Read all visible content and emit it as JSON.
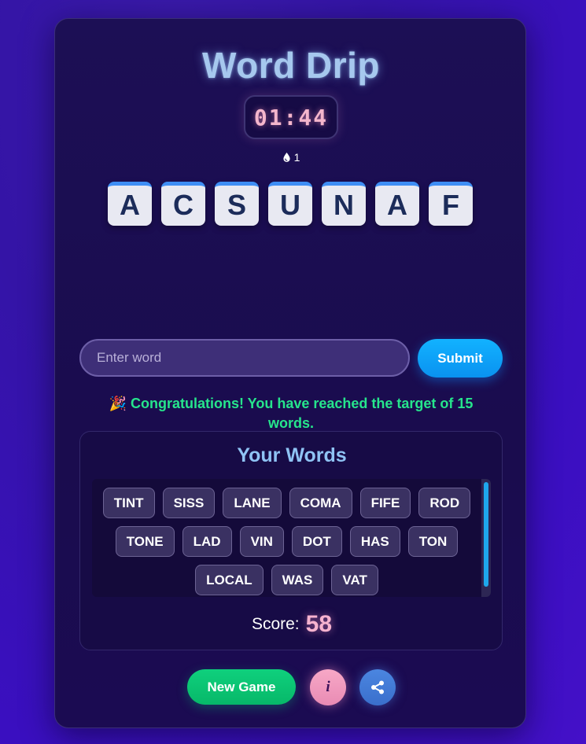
{
  "game": {
    "title": "Word Drip",
    "timer": "01:44",
    "streak_icon": "drop-icon",
    "streak_count": "1",
    "letters": [
      "A",
      "C",
      "S",
      "U",
      "N",
      "A",
      "F"
    ]
  },
  "input": {
    "placeholder": "Enter word",
    "value": "",
    "submit_label": "Submit"
  },
  "message": {
    "icon": "🎉",
    "text": "Congratulations! You have reached the target of 15 words."
  },
  "words_panel": {
    "title": "Your Words",
    "words": [
      "TINT",
      "SISS",
      "LANE",
      "COMA",
      "FIFE",
      "ROD",
      "TONE",
      "LAD",
      "VIN",
      "DOT",
      "HAS",
      "TON",
      "LOCAL",
      "WAS",
      "VAT"
    ],
    "score_label": "Score:",
    "score_value": "58"
  },
  "footer": {
    "new_game_label": "New Game",
    "info_label": "i",
    "share_icon": "share-icon"
  },
  "colors": {
    "background": "#3414a6",
    "card": "#1c0f55",
    "tile_accent": "#3e8ef5",
    "submit": "#12b2ff",
    "success": "#26e58c",
    "score": "#f6b3cf",
    "new_game": "#0fd07d",
    "info": "#f7a8c6",
    "share": "#4b86e0"
  }
}
